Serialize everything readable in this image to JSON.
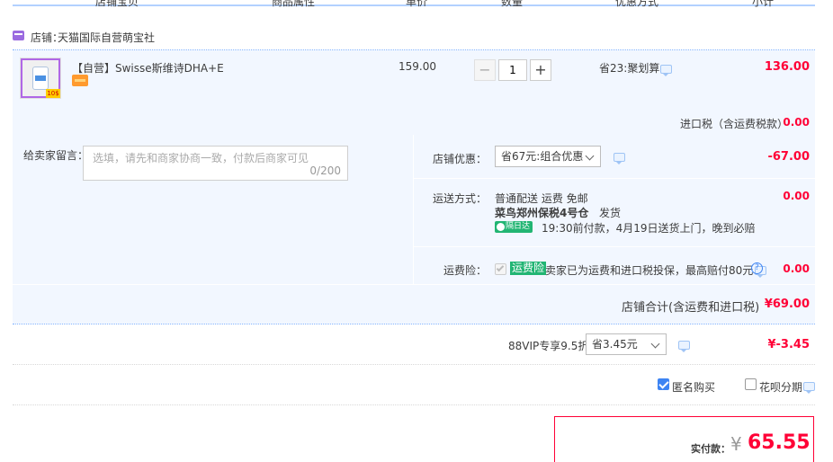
{
  "header": {
    "columns": [
      "店铺宝贝",
      "商品属性",
      "单价",
      "数量",
      "优惠方式",
      "小计"
    ]
  },
  "shop": {
    "label": "店铺：",
    "name": "天猫国际自营萌宝社"
  },
  "item": {
    "title": "【自营】Swisse斯维诗DHA+E...",
    "thumb_badge": "10$",
    "unit_price": "159.00",
    "quantity": "1",
    "discount": "省23:聚划算",
    "subtotal": "136.00"
  },
  "tax": {
    "label": "进口税（含运费税款）",
    "value": "0.00"
  },
  "message": {
    "label": "给卖家留言：",
    "placeholder": "选填，请先和商家协商一致，付款后商家可见",
    "counter": "0/200"
  },
  "shop_discount": {
    "label": "店铺优惠：",
    "selected": "省67元:组合优惠",
    "value": "-67.00"
  },
  "shipping": {
    "label": "运送方式：",
    "line1": "普通配送 运费 免邮",
    "warehouse": "菜鸟郑州保税4号仓",
    "ship_word": "发货",
    "badge": "隔日达",
    "promise": "19:30前付款，4月19日送货上门，晚到必赔",
    "value": "0.00"
  },
  "insurance": {
    "label": "运费险：",
    "tag": "运费险",
    "text": "卖家已为运费和进口税投保，最高赔付80元",
    "value": "0.00"
  },
  "shop_total": {
    "label": "店铺合计(含运费和进口税)",
    "value": "¥69.00"
  },
  "vip": {
    "label": "88VIP专享9.5折",
    "selected": "省3.45元",
    "value": "¥-3.45"
  },
  "options": {
    "anonymous": "匿名购买",
    "huabei": "花呗分期"
  },
  "payment": {
    "label": "实付款：",
    "currency": "¥",
    "amount": "65.55"
  },
  "colors": {
    "accent_red": "#ff0036",
    "accent_blue": "#3d84f3",
    "panel_bg": "#f2f7ff"
  }
}
